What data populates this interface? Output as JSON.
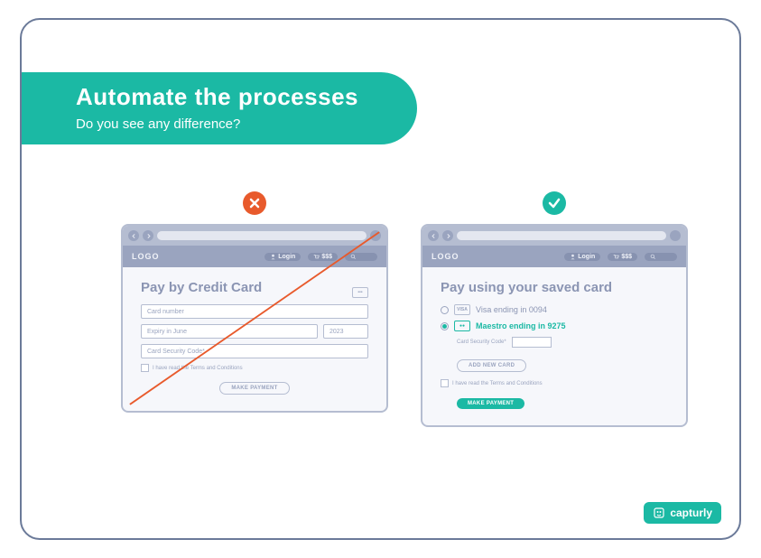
{
  "header": {
    "title": "Automate the processes",
    "subtitle": "Do you see any difference?"
  },
  "bad_panel": {
    "logo": "LOGO",
    "login": "Login",
    "cart": "$$$",
    "title": "Pay by Credit Card",
    "card_number_placeholder": "Card number",
    "expiry_placeholder": "Expiry in June",
    "year_placeholder": "2023",
    "security_placeholder": "Card Security Code*",
    "terms": "I have read the Terms and Conditions",
    "pay_btn": "MAKE PAYMENT"
  },
  "good_panel": {
    "logo": "LOGO",
    "login": "Login",
    "cart": "$$$",
    "title": "Pay using your saved card",
    "card1": {
      "brand": "VISA",
      "label": "Visa ending in 0094"
    },
    "card2": {
      "brand": "card",
      "label": "Maestro ending in 9275"
    },
    "security_label": "Card Security Code*",
    "add_card_btn": "ADD NEW CARD",
    "terms": "I have read the Terms and Conditions",
    "pay_btn": "MAKE PAYMENT"
  },
  "brand": "capturly"
}
